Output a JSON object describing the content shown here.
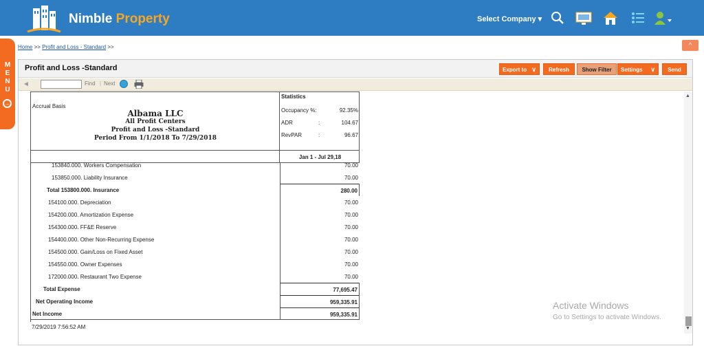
{
  "header": {
    "brand_part1": "Nimble",
    "brand_part2": "Property",
    "select_company": "Select Company ▾"
  },
  "side_menu": {
    "letters": [
      "M",
      "E",
      "N",
      "U"
    ],
    "icon": "arrow-circle-right-icon"
  },
  "breadcrumb": {
    "home": "Home",
    "sep": ">>",
    "report": "Profit and Loss - Standard",
    "trail_sep": ">>"
  },
  "collapse": "^",
  "panel": {
    "title": "Profit and Loss -Standard",
    "buttons": {
      "export": "Export to",
      "refresh": "Refresh",
      "show_filter": "Show Filter",
      "settings": "Settings",
      "send": "Send"
    }
  },
  "viewer": {
    "find": "Find",
    "sep": "|",
    "next": "Next"
  },
  "report": {
    "basis": "Accrual Basis",
    "company": "Albama LLC",
    "centers": "All Profit Centers",
    "title": "Profit and Loss -Standard",
    "period": "Period From 1/1/2018 To 7/29/2018",
    "statistics": {
      "label": "Statistics",
      "items": [
        {
          "name": "Occupancy %:",
          "colon": "",
          "value": "92.35%"
        },
        {
          "name": "ADR",
          "colon": ":",
          "value": "104.67"
        },
        {
          "name": "RevPAR",
          "colon": ":",
          "value": "96.67"
        }
      ]
    },
    "column_header": "Jan 1 - Jul 29,18",
    "rows": [
      {
        "label": "153840.000. Workers Compensation",
        "amount": "70.00"
      },
      {
        "label": "153850.000. Liability Insurance",
        "amount": "70.00"
      },
      {
        "label": "Total 153800.000. Insurance",
        "amount": "280.00"
      },
      {
        "label": "154100.000. Depreciation",
        "amount": "70.00"
      },
      {
        "label": "154200.000. Amortization Expense",
        "amount": "70.00"
      },
      {
        "label": "154300.000. FF&E Reserve",
        "amount": "70.00"
      },
      {
        "label": "154400.000. Other Non-Recurring Expense",
        "amount": "70.00"
      },
      {
        "label": "154500.000. Gain/Loss on Fixed Asset",
        "amount": "70.00"
      },
      {
        "label": "154550.000. Owner Expenses",
        "amount": "70.00"
      },
      {
        "label": "172000.000. Restaurant Two Expense",
        "amount": "70.00"
      },
      {
        "label": "Total Expense",
        "amount": "77,695.47"
      },
      {
        "label": "Net Operating Income",
        "amount": "959,335.91"
      },
      {
        "label": "Net Income",
        "amount": "959,335.91"
      }
    ],
    "timestamp": "7/29/2019 7:56:52 AM"
  },
  "watermark": {
    "line1": "Activate Windows",
    "line2": "Go to Settings to activate Windows."
  },
  "colors": {
    "header_blue": "#2e7cc1",
    "accent_orange": "#f26b21",
    "brand_orange": "#f5a623"
  }
}
